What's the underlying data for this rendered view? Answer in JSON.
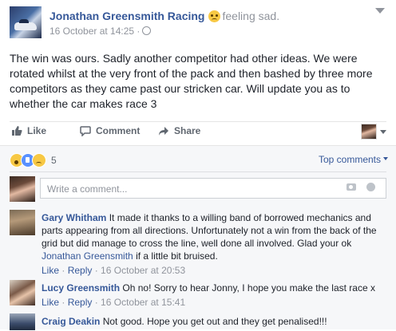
{
  "post": {
    "page_name": "Jonathan Greensmith Racing",
    "feeling": "feeling sad.",
    "timestamp": "16 October at 14:25",
    "separator": "·",
    "body": "The win was ours. Sadly another competitor had other ideas. We were rotated whilst at the very front of the pack and then bashed by three more competitors as they came past our stricken car. Will update you as to whether the car makes race 3"
  },
  "actions": {
    "like": "Like",
    "comment": "Comment",
    "share": "Share"
  },
  "reactions": {
    "count": "5",
    "sort_label": "Top comments"
  },
  "composer": {
    "placeholder": "Write a comment..."
  },
  "comments": [
    {
      "author": "Gary Whitham",
      "text": "It made it thanks to a willing band of borrowed mechanics and parts appearing from all directions. Unfortunately not a win from the back of the grid but did manage to cross the line, well done all involved. Glad your ok",
      "mention": "Jonathan Greensmith",
      "text_after": "if a little bit bruised.",
      "like": "Like",
      "reply": "Reply",
      "time": "16 October at 20:53"
    },
    {
      "author": "Lucy Greensmith",
      "text": "Oh no! Sorry to hear Jonny, I hope you make the last race x",
      "like": "Like",
      "reply": "Reply",
      "time": "16 October at 15:41"
    },
    {
      "author": "Craig Deakin",
      "text": "Not good. Hope you get out and they get penalised!!!"
    }
  ],
  "colors": {
    "link": "#365899",
    "meta": "#90949c",
    "background_comments": "#f6f7f9"
  }
}
